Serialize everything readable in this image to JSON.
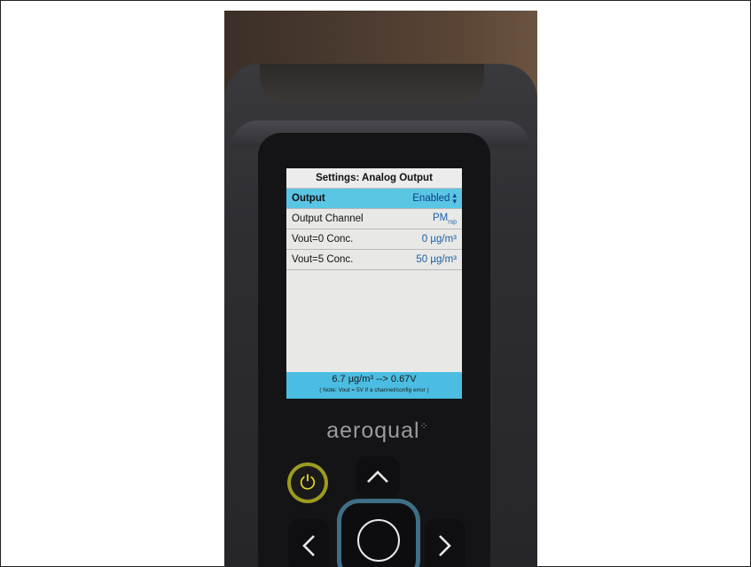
{
  "screen": {
    "title": "Settings: Analog Output",
    "rows": [
      {
        "label": "Output",
        "value": "Enabled",
        "selected": true
      },
      {
        "label": "Output Channel",
        "value": "PM",
        "value_sub": "rsp",
        "selected": false
      },
      {
        "label": "Vout=0 Conc.",
        "value": "0 µg/m³",
        "selected": false
      },
      {
        "label": "Vout=5 Conc.",
        "value": "50 µg/m³",
        "selected": false
      }
    ],
    "footer": {
      "live_reading": "6.7 µg/m³ --> 0.67V",
      "note": "( Note: Vout = 5V if a channel/config error )"
    }
  },
  "device": {
    "brand": "aeroqual",
    "buttons": [
      "power",
      "up",
      "left",
      "ok",
      "right"
    ]
  },
  "colors": {
    "selected_row": "#5bc5e4",
    "footer": "#4bbde2",
    "value_text": "#1b5fa7",
    "power_ring": "#c9c31c"
  }
}
